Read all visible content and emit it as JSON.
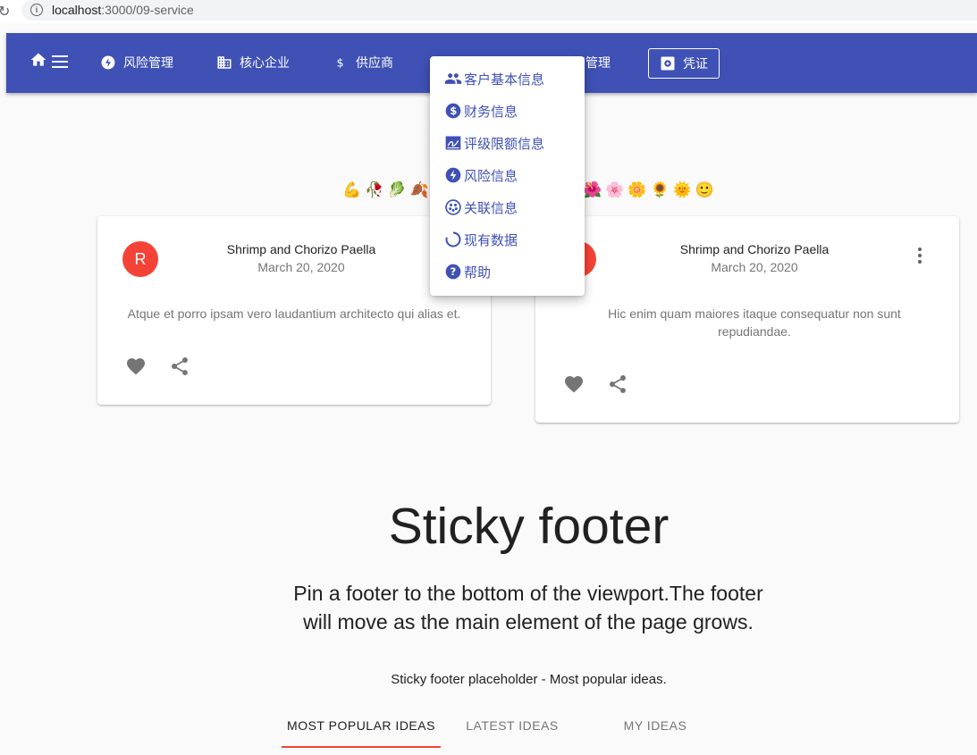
{
  "browser": {
    "url_host": "localhost",
    "url_path": ":3000/09-service"
  },
  "navbar": {
    "items": [
      {
        "label": "风险管理",
        "icon": "flash-icon"
      },
      {
        "label": "核心企业",
        "icon": "business-icon"
      },
      {
        "label": "供应商",
        "icon": "dollar-icon"
      },
      {
        "label": "融资管理",
        "icon": ""
      },
      {
        "label": "凭证",
        "icon": "settings-icon"
      }
    ]
  },
  "menu": {
    "items": [
      {
        "label": "客户基本信息",
        "icon": "people-icon"
      },
      {
        "label": "财务信息",
        "icon": "monetization-icon"
      },
      {
        "label": "评级限额信息",
        "icon": "signature-icon"
      },
      {
        "label": "风险信息",
        "icon": "flash-circle-icon"
      },
      {
        "label": "关联信息",
        "icon": "scatter-icon"
      },
      {
        "label": "现有数据",
        "icon": "loading-icon"
      },
      {
        "label": "帮助",
        "icon": "help-icon"
      }
    ]
  },
  "emoji_row": {
    "left": "💪🥀🥬🍂🌿",
    "right": "🌺🌸🌼🌻🌞🙂"
  },
  "cards": [
    {
      "avatar": "R",
      "title": "Shrimp and Chorizo Paella",
      "date": "March 20, 2020",
      "body": "Atque et porro ipsam vero laudantium architecto qui alias et."
    },
    {
      "avatar": "R",
      "title": "Shrimp and Chorizo Paella",
      "date": "March 20, 2020",
      "body": "Hic enim quam maiores itaque consequatur non sunt repudiandae."
    }
  ],
  "hero": {
    "title": "Sticky footer",
    "subtitle": "Pin a footer to the bottom of the viewport.The footer will move as the main element of the page grows.",
    "note": "Sticky footer placeholder - Most popular ideas."
  },
  "tabs": [
    {
      "label": "MOST POPULAR IDEAS",
      "active": true
    },
    {
      "label": "LATEST IDEAS",
      "active": false
    },
    {
      "label": "MY IDEAS",
      "active": false
    }
  ],
  "colors": {
    "primary": "#3f51b5",
    "accent": "#f44336",
    "background": "#fafafa"
  }
}
